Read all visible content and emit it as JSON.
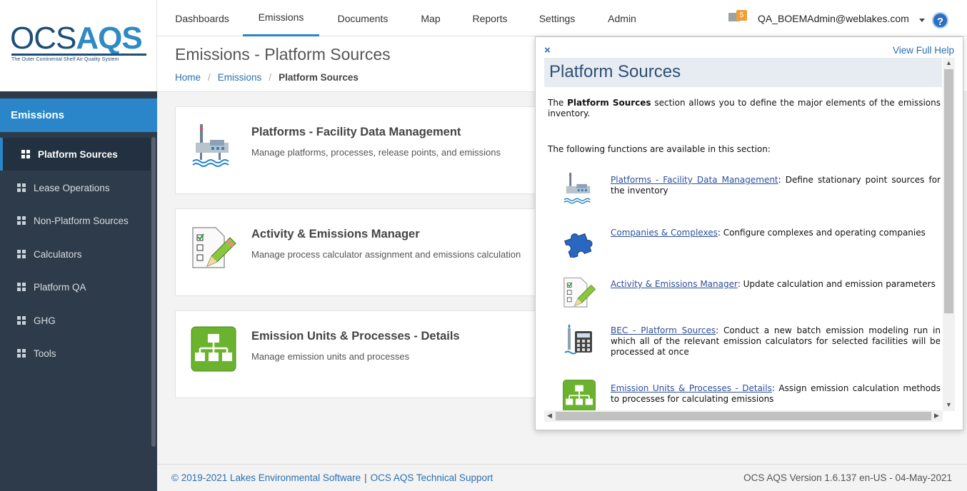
{
  "logo": {
    "ocs": "OCS",
    "aqs": "AQS",
    "tagline": "The Outer Continental Shelf Air Quality System"
  },
  "sidebar": {
    "section": "Emissions",
    "items": [
      {
        "label": "Platform Sources",
        "icon": "grid-icon",
        "active": true
      },
      {
        "label": "Lease Operations",
        "icon": "grid-icon"
      },
      {
        "label": "Non-Platform Sources",
        "icon": "grid-icon"
      },
      {
        "label": "Calculators",
        "icon": "grid-icon"
      },
      {
        "label": "Platform QA",
        "icon": "grid-icon"
      },
      {
        "label": "GHG",
        "icon": "grid-icon"
      },
      {
        "label": "Tools",
        "icon": "grid-icon"
      }
    ]
  },
  "topnav": {
    "tabs": [
      "Dashboards",
      "Emissions",
      "Documents",
      "Map",
      "Reports",
      "Settings",
      "Admin"
    ],
    "active_tab": "Emissions",
    "mail_count": "5",
    "user": "QA_BOEMAdmin@weblakes.com",
    "help": "?"
  },
  "page": {
    "title": "Emissions - Platform Sources",
    "breadcrumb": {
      "home": "Home",
      "section": "Emissions",
      "current": "Platform Sources"
    }
  },
  "cards": [
    {
      "title": "Platforms - Facility Data Management",
      "desc": "Manage platforms, processes, release points, and emissions",
      "icon": "platform-icon"
    },
    {
      "title": "Activity & Emissions Manager",
      "desc": "Manage process calculator assignment and emissions calculation",
      "icon": "checklist-pencil-icon"
    },
    {
      "title": "Emission Units & Processes - Details",
      "desc": "Manage emission units and processes",
      "icon": "hierarchy-icon"
    }
  ],
  "help": {
    "close": "×",
    "view_full": "View Full Help",
    "heading": "Platform Sources",
    "intro_pre": "The ",
    "intro_bold": "Platform Sources",
    "intro_post": " section allows you to define the major elements of the emissions inventory.",
    "functions_intro": "The following functions are available in this section:",
    "items": [
      {
        "link": "Platforms - Facility Data Management",
        "text": ": Define stationary point sources for the inventory",
        "icon": "platform-icon"
      },
      {
        "link": "Companies & Complexes",
        "text": ": Configure complexes and operating companies",
        "icon": "puzzle-icon"
      },
      {
        "link": "Activity & Emissions Manager",
        "text": ": Update calculation and emission parameters",
        "icon": "checklist-pencil-icon"
      },
      {
        "link": "BEC - Platform Sources",
        "text": ": Conduct a new batch emission modeling run in which all of the relevant emission calculators for selected facilities will be processed at once",
        "icon": "calculator-icon"
      },
      {
        "link": "Emission Units & Processes - Details",
        "text": ": Assign emission calculation methods to processes for calculating emissions",
        "icon": "hierarchy-icon"
      }
    ]
  },
  "footer": {
    "copyright": "© 2019-2021 Lakes Environmental Software",
    "separator": "|",
    "support": "OCS AQS Technical Support",
    "version": "OCS AQS Version 1.6.137 en-US - 04-May-2021"
  },
  "colors": {
    "primary": "#2a86c8",
    "sidebar": "#2e3b4a",
    "link": "#2a6fb0"
  }
}
